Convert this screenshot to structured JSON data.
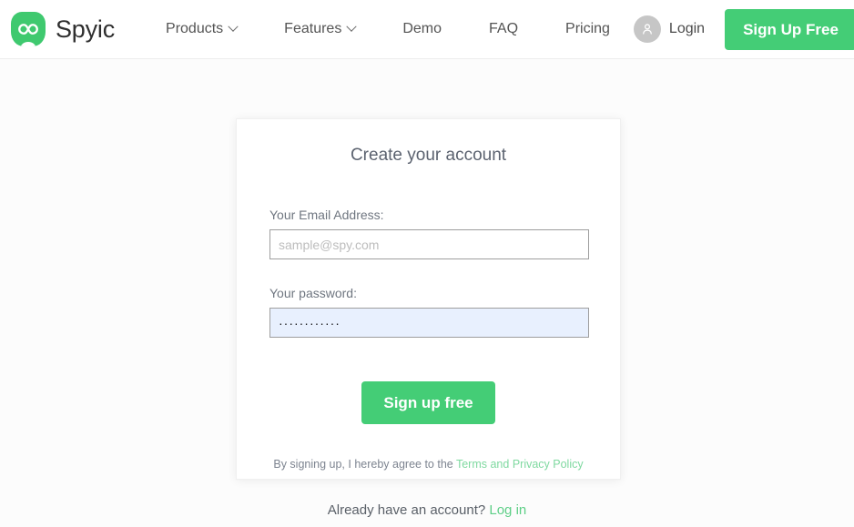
{
  "brand": {
    "name": "Spyic",
    "logo_icon": "infinity-logo-icon",
    "logo_color": "#3fc96f"
  },
  "header": {
    "nav": [
      {
        "label": "Products",
        "has_dropdown": true
      },
      {
        "label": "Features",
        "has_dropdown": true
      },
      {
        "label": "Demo",
        "has_dropdown": false
      },
      {
        "label": "FAQ",
        "has_dropdown": false
      },
      {
        "label": "Pricing",
        "has_dropdown": false
      }
    ],
    "login_label": "Login",
    "login_icon": "user-avatar-icon",
    "signup_button_label": "Sign Up Free",
    "accent_color": "#44cd76"
  },
  "signup_card": {
    "title": "Create your account",
    "email": {
      "label": "Your Email Address:",
      "placeholder": "sample@spy.com",
      "value": ""
    },
    "password": {
      "label": "Your password:",
      "placeholder": "",
      "value": "············",
      "masked_char_count": 12
    },
    "submit_label": "Sign up free",
    "terms_prefix": "By signing up, I hereby agree to the ",
    "terms_link_label": "Terms and Privacy Policy"
  },
  "footer_prompt": {
    "text": "Already have an account? ",
    "link_label": "Log in"
  }
}
